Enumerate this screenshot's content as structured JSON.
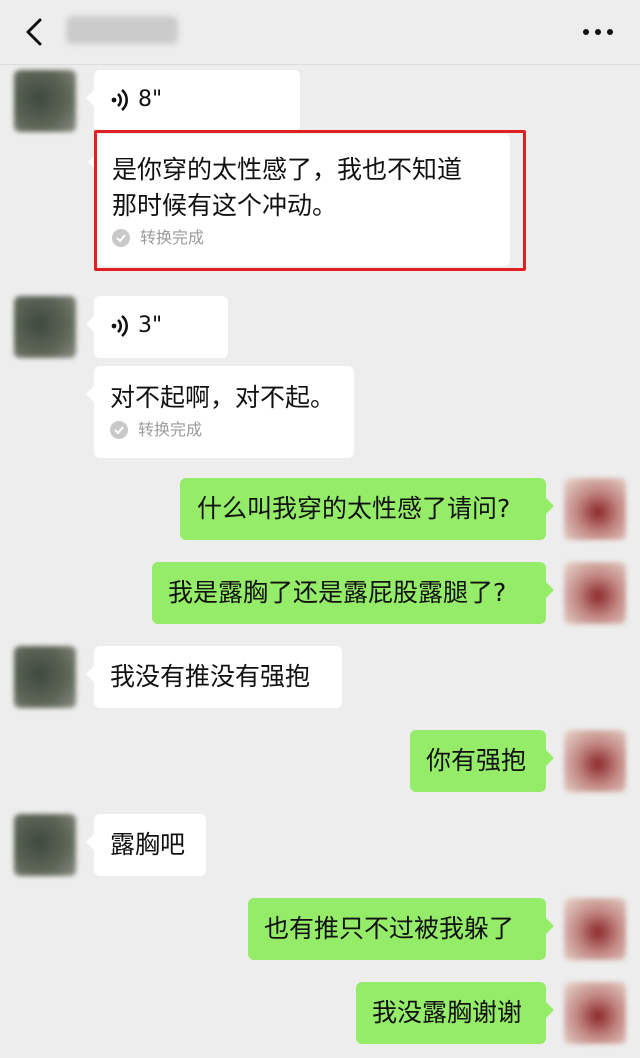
{
  "header": {
    "back_icon": "chevron-left-icon",
    "more_icon": "ellipsis-icon"
  },
  "messages": [
    {
      "side": "left",
      "type": "voice",
      "duration": "8\""
    },
    {
      "side": "left",
      "type": "transcript",
      "text_line1": "是你穿的太性感了，我也不知道",
      "text_line2": "那时候有这个冲动。",
      "status": "转换完成",
      "highlighted": true
    },
    {
      "side": "left",
      "type": "voice",
      "duration": "3\""
    },
    {
      "side": "left",
      "type": "transcript",
      "text_line1": "对不起啊，对不起。",
      "status": "转换完成"
    },
    {
      "side": "right",
      "type": "text",
      "text": "什么叫我穿的太性感了请问?"
    },
    {
      "side": "right",
      "type": "text",
      "text": "我是露胸了还是露屁股露腿了?"
    },
    {
      "side": "left",
      "type": "text",
      "text": "我没有推没有强抱"
    },
    {
      "side": "right",
      "type": "text",
      "text": "你有强抱"
    },
    {
      "side": "left",
      "type": "text",
      "text": "露胸吧"
    },
    {
      "side": "right",
      "type": "text",
      "text": "也有推只不过被我躲了"
    },
    {
      "side": "right",
      "type": "text",
      "text": "我没露胸谢谢"
    }
  ],
  "colors": {
    "background": "#ededed",
    "incoming_bubble": "#ffffff",
    "outgoing_bubble": "#95ec69",
    "highlight_border": "#e02020"
  }
}
